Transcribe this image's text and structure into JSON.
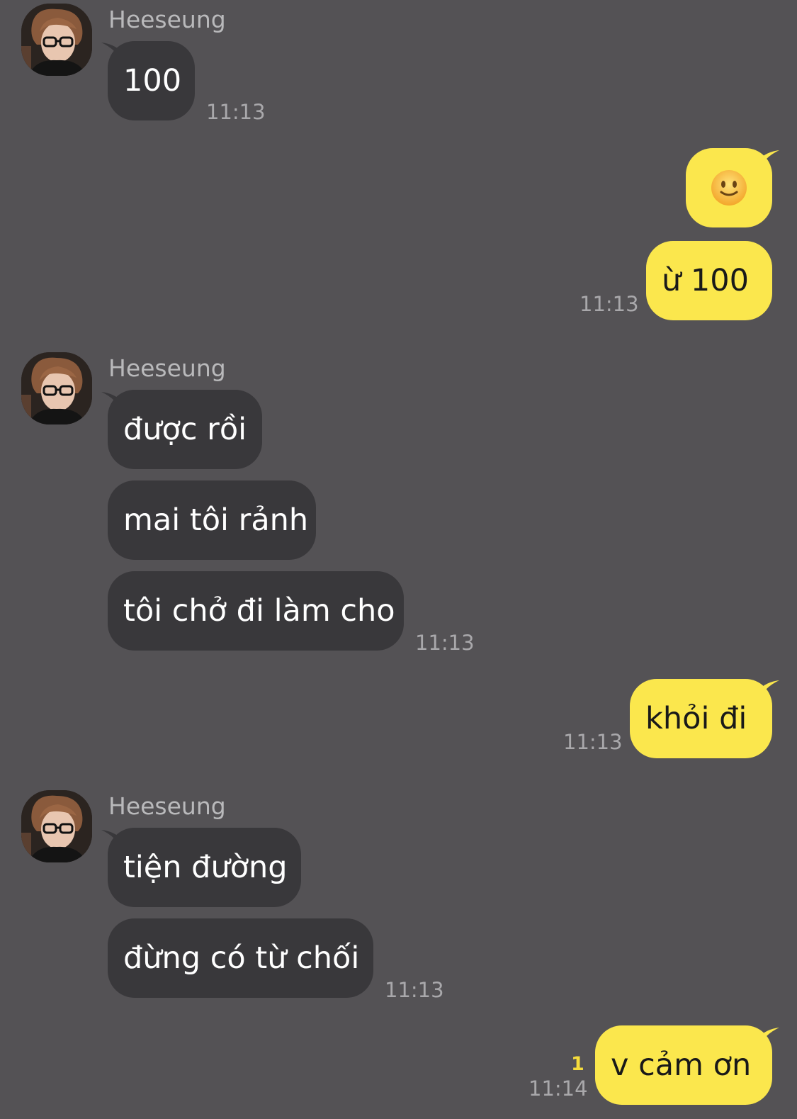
{
  "sender_name": "Heeseung",
  "messages": {
    "m1": {
      "text": "100",
      "time": "11:13"
    },
    "m2": {
      "emoji": "slightly-smiling-face-icon"
    },
    "m3": {
      "text": "ừ 100",
      "time": "11:13"
    },
    "m4": {
      "text": "được rồi"
    },
    "m5": {
      "text": "mai tôi rảnh"
    },
    "m6": {
      "text": "tôi chở đi làm cho",
      "time": "11:13"
    },
    "m7": {
      "text": "khỏi đi",
      "time": "11:13"
    },
    "m8": {
      "text": "tiện đường"
    },
    "m9": {
      "text": "đừng có từ chối",
      "time": "11:13"
    },
    "m10": {
      "text": "v cảm ơn",
      "time": "11:14",
      "unread": "1"
    }
  },
  "colors": {
    "background": "#545255",
    "incoming_bubble": "#39383b",
    "outgoing_bubble": "#fbe74d",
    "unread_count": "#f5dc3c"
  }
}
